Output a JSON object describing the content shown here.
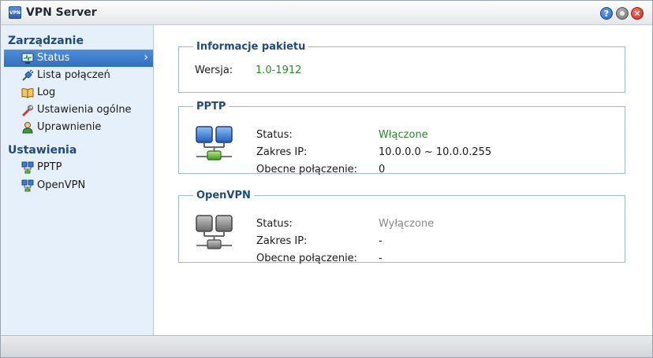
{
  "window": {
    "title": "VPN Server",
    "app_icon": "vpn-app-icon"
  },
  "sidebar": {
    "sections": [
      {
        "title": "Zarządzanie",
        "items": [
          {
            "label": "Status",
            "icon": "monitor-icon",
            "active": true
          },
          {
            "label": "Lista połączeń",
            "icon": "connection-plug-icon"
          },
          {
            "label": "Log",
            "icon": "book-icon"
          },
          {
            "label": "Ustawienia ogólne",
            "icon": "wrench-icon"
          },
          {
            "label": "Uprawnienie",
            "icon": "user-icon"
          }
        ]
      },
      {
        "title": "Ustawienia",
        "items": [
          {
            "label": "PPTP",
            "icon": "network-icon"
          },
          {
            "label": "OpenVPN",
            "icon": "network-icon"
          }
        ]
      }
    ]
  },
  "info": {
    "legend": "Informacje pakietu",
    "version_label": "Wersja:",
    "version_value": "1.0-1912"
  },
  "pptp": {
    "legend": "PPTP",
    "status_label": "Status:",
    "status_value": "Włączone",
    "ip_label": "Zakres IP:",
    "ip_value": "10.0.0.0 ~ 10.0.0.255",
    "conn_label": "Obecne połączenie:",
    "conn_value": "0"
  },
  "openvpn": {
    "legend": "OpenVPN",
    "status_label": "Status:",
    "status_value": "Wyłączone",
    "ip_label": "Zakres IP:",
    "ip_value": "-",
    "conn_label": "Obecne połączenie:",
    "conn_value": "-"
  },
  "colors": {
    "accent": "#2f6fbf",
    "enabled": "#2a8a2a",
    "disabled": "#888888",
    "section": "#1f4a7c"
  }
}
